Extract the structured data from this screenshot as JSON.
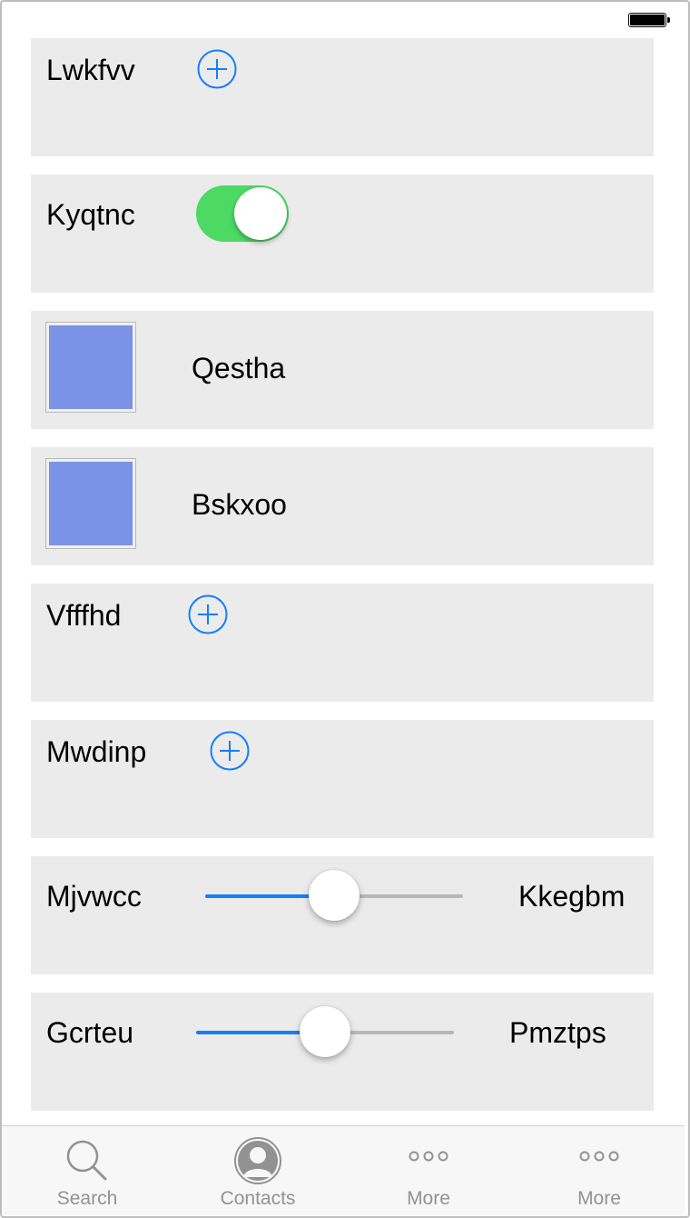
{
  "colors": {
    "accent": "#147efb",
    "toggle_on": "#4cd964",
    "card_bg": "#ebebeb",
    "thumbnail": "#7a93e6",
    "tab_inactive": "#929292"
  },
  "rows": [
    {
      "type": "add",
      "label": "Lwkfvv",
      "icon": "plus-circle-icon"
    },
    {
      "type": "toggle",
      "label": "Kyqtnc",
      "checked": true
    },
    {
      "type": "thumbnail",
      "label": "Qestha"
    },
    {
      "type": "thumbnail",
      "label": "Bskxoo"
    },
    {
      "type": "add",
      "label": "Vfffhd",
      "icon": "plus-circle-icon"
    },
    {
      "type": "add",
      "label": "Mwdinp",
      "icon": "plus-circle-icon"
    },
    {
      "type": "slider",
      "label": "Mjvwcc",
      "value_label": "Kkegbm",
      "value": 0.5
    },
    {
      "type": "slider",
      "label": "Gcrteu",
      "value_label": "Pmztps",
      "value": 0.5
    }
  ],
  "tab_bar": {
    "tabs": [
      {
        "label": "Search",
        "icon": "search-icon"
      },
      {
        "label": "Contacts",
        "icon": "contacts-icon"
      },
      {
        "label": "More",
        "icon": "more-icon"
      },
      {
        "label": "More",
        "icon": "more-icon"
      }
    ]
  }
}
